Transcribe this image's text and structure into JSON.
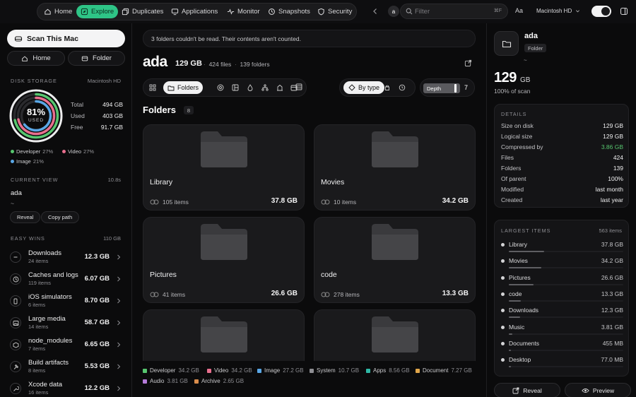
{
  "nav": {
    "tabs": [
      {
        "label": "Home",
        "icon": "home-icon"
      },
      {
        "label": "Explore",
        "icon": "compass-icon",
        "active": true
      },
      {
        "label": "Duplicates",
        "icon": "duplicate-icon"
      },
      {
        "label": "Applications",
        "icon": "monitor-icon"
      },
      {
        "label": "Monitor",
        "icon": "pulse-icon"
      },
      {
        "label": "Snapshots",
        "icon": "history-icon"
      },
      {
        "label": "Security",
        "icon": "shield-icon"
      }
    ],
    "search_badge": "a",
    "search_placeholder": "Filter",
    "search_shortcut": "⌘F",
    "text_size_label": "Aa",
    "disk": "Macintosh HD",
    "accent": "#2ec486"
  },
  "sidebar": {
    "scan_label": "Scan This Mac",
    "home_label": "Home",
    "folder_label": "Folder",
    "disk_storage_label": "DISK STORAGE",
    "disk_name": "Macintosh HD",
    "gauge_pct": "81%",
    "gauge_used": 0.81,
    "gauge_sub": "USED",
    "total_label": "Total",
    "total": "494 GB",
    "used_label": "Used",
    "used": "403 GB",
    "free_label": "Free",
    "free": "91.7 GB",
    "legend": [
      {
        "name": "Developer",
        "pct": "27%",
        "color": "#57c66f"
      },
      {
        "name": "Video",
        "pct": "27%",
        "color": "#e86f8e"
      },
      {
        "name": "Image",
        "pct": "21%",
        "color": "#5aa7e6"
      }
    ],
    "current_view_label": "CURRENT VIEW",
    "current_view_time": "10.8s",
    "current_name": "ada",
    "current_path": "~",
    "reveal_label": "Reveal",
    "copy_path_label": "Copy path",
    "easy_wins_label": "EASY WINS",
    "easy_wins_total": "110 GB",
    "wins": [
      {
        "title": "Downloads",
        "sub": "24 items",
        "size": "12.3 GB",
        "icon": "download-icon"
      },
      {
        "title": "Caches and logs",
        "sub": "119 items",
        "size": "6.07 GB",
        "icon": "clock-icon"
      },
      {
        "title": "iOS simulators",
        "sub": "6 items",
        "size": "8.70 GB",
        "icon": "phone-icon"
      },
      {
        "title": "Large media",
        "sub": "14 items",
        "size": "58.7 GB",
        "icon": "image-icon"
      },
      {
        "title": "node_modules",
        "sub": "7 items",
        "size": "6.65 GB",
        "icon": "package-icon"
      },
      {
        "title": "Build artifacts",
        "sub": "8 items",
        "size": "5.53 GB",
        "icon": "hammer-icon"
      },
      {
        "title": "Xcode data",
        "sub": "16 items",
        "size": "12.2 GB",
        "icon": "wrench-icon"
      }
    ]
  },
  "main": {
    "notice": "3 folders couldn't be read. Their contents aren't counted.",
    "title": "ada",
    "size": "129 GB",
    "files": "424 files",
    "folders_count_label": "139 folders",
    "view_folders_label": "Folders",
    "sort_label": "By type",
    "depth_label": "Depth",
    "depth_value": "7",
    "folders_heading": "Folders",
    "folders_badge": "8",
    "cards": [
      {
        "name": "Library",
        "items": "105 items",
        "size": "37.8 GB"
      },
      {
        "name": "Movies",
        "items": "10 items",
        "size": "34.2 GB"
      },
      {
        "name": "Pictures",
        "items": "41 items",
        "size": "26.6 GB"
      },
      {
        "name": "code",
        "items": "278 items",
        "size": "13.3 GB"
      },
      {
        "name": "",
        "items": "",
        "size": ""
      },
      {
        "name": "",
        "items": "",
        "size": ""
      }
    ],
    "type_legend": [
      {
        "name": "Developer",
        "value": "34.2 GB",
        "color": "#57c66f"
      },
      {
        "name": "Video",
        "value": "34.2 GB",
        "color": "#e86f8e"
      },
      {
        "name": "Image",
        "value": "27.2 GB",
        "color": "#5aa7e6"
      },
      {
        "name": "System",
        "value": "10.7 GB",
        "color": "#8e8e93"
      },
      {
        "name": "Apps",
        "value": "8.56 GB",
        "color": "#2fb9a6"
      },
      {
        "name": "Document",
        "value": "7.27 GB",
        "color": "#e0a64a"
      },
      {
        "name": "Audio",
        "value": "3.81 GB",
        "color": "#b57bd9"
      },
      {
        "name": "Archive",
        "value": "2.65 GB",
        "color": "#d98d4c"
      }
    ]
  },
  "rpanel": {
    "name": "ada",
    "kind": "Folder",
    "path": "~",
    "size_num": "129",
    "size_unit": "GB",
    "pct_of_scan": "100% of scan",
    "details_label": "DETAILS",
    "details": [
      {
        "k": "Size on disk",
        "v": "129 GB"
      },
      {
        "k": "Logical size",
        "v": "129 GB"
      },
      {
        "k": "Compressed by",
        "v": "3.86 GB",
        "accent": true
      },
      {
        "k": "Files",
        "v": "424"
      },
      {
        "k": "Folders",
        "v": "139"
      },
      {
        "k": "Of parent",
        "v": "100%"
      },
      {
        "k": "Modified",
        "v": "last month"
      },
      {
        "k": "Created",
        "v": "last year"
      }
    ],
    "largest_label": "LARGEST ITEMS",
    "largest_count": "563 items",
    "largest": [
      {
        "name": "Library",
        "size": "37.8 GB",
        "frac": 0.32
      },
      {
        "name": "Movies",
        "size": "34.2 GB",
        "frac": 0.29
      },
      {
        "name": "Pictures",
        "size": "26.6 GB",
        "frac": 0.22
      },
      {
        "name": "code",
        "size": "13.3 GB",
        "frac": 0.11
      },
      {
        "name": "Downloads",
        "size": "12.3 GB",
        "frac": 0.1
      },
      {
        "name": "Music",
        "size": "3.81 GB",
        "frac": 0.03
      },
      {
        "name": "Documents",
        "size": "455 MB",
        "frac": 0.01
      },
      {
        "name": "Desktop",
        "size": "77.0 MB",
        "frac": 0.005
      }
    ],
    "reveal_label": "Reveal",
    "preview_label": "Preview"
  }
}
